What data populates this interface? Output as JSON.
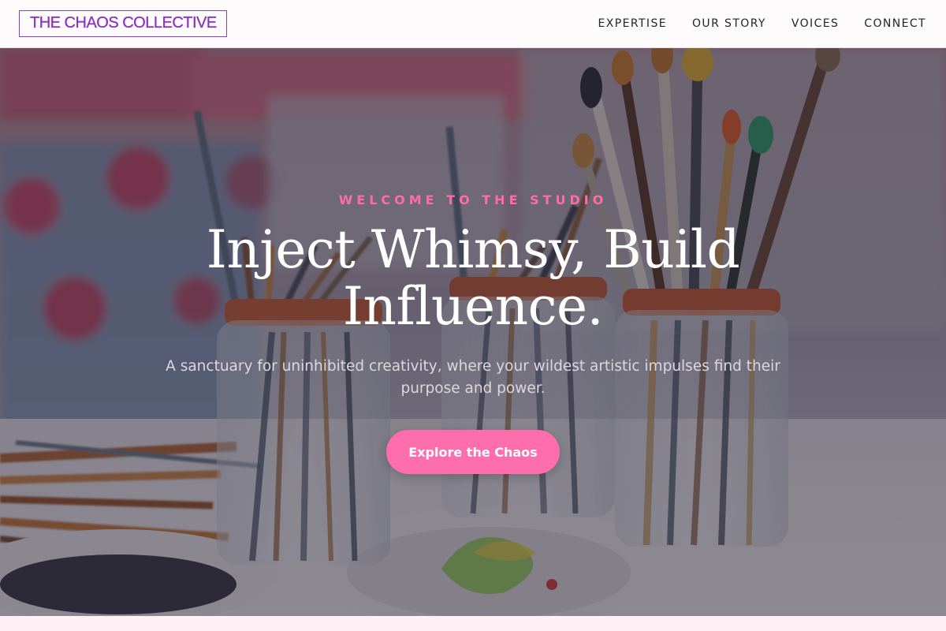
{
  "header": {
    "logo_text": "THE CHAOS COLLECTIVE",
    "nav": [
      {
        "label": "EXPERTISE"
      },
      {
        "label": "OUR STORY"
      },
      {
        "label": "VOICES"
      },
      {
        "label": "CONNECT"
      }
    ]
  },
  "hero": {
    "eyebrow": "WELCOME TO THE STUDIO",
    "headline_line1": "Inject Whimsy, Build",
    "headline_line2": "Influence.",
    "subheadline": "A sanctuary for uninhibited creativity, where your wildest artistic impulses find their purpose and power.",
    "cta_label": "Explore the Chaos",
    "image_subject": "paintbrushes in glass jars on a table"
  },
  "colors": {
    "brand_purple": "#8b34c4",
    "accent_pink": "#fe6eac",
    "nav_text": "#23232b",
    "header_bg": "#fefbfd"
  }
}
